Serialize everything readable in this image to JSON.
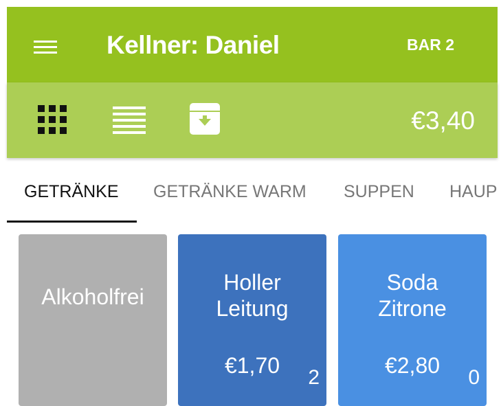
{
  "header": {
    "title": "Kellner: Daniel",
    "table": "BAR 2",
    "color": "#95c11f"
  },
  "toolbar": {
    "total": "€3,40",
    "color": "#acce55",
    "icons": [
      "grid-view-icon",
      "list-view-icon",
      "archive-icon"
    ]
  },
  "tabs": [
    {
      "label": "GETRÄNKE",
      "active": true
    },
    {
      "label": "GETRÄNKE WARM",
      "active": false
    },
    {
      "label": "SUPPEN",
      "active": false
    },
    {
      "label": "HAUP",
      "active": false
    }
  ],
  "tiles": [
    {
      "name": "Alkoholfrei",
      "color": "#b0b0b0"
    },
    {
      "name_line1": "Holler",
      "name_line2": "Leitung",
      "price": "€1,70",
      "count": "2",
      "color": "#3d72bd"
    },
    {
      "name_line1": "Soda",
      "name_line2": "Zitrone",
      "price": "€2,80",
      "count": "0",
      "color": "#4a90e2"
    }
  ]
}
